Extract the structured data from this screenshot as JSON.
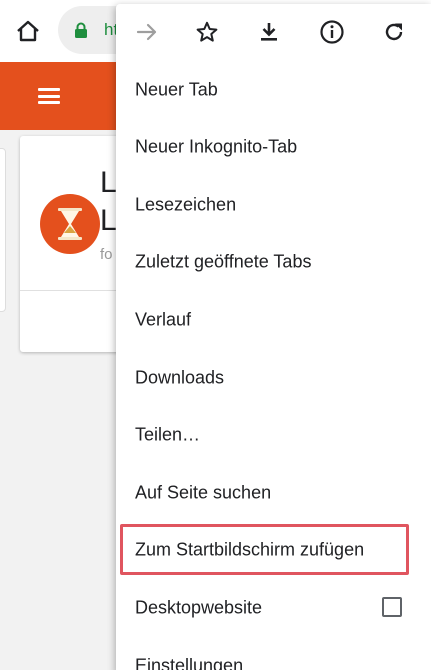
{
  "browser": {
    "url_partial": "ht",
    "icons": {
      "home": "home-icon",
      "lock": "lock-icon"
    },
    "colors": {
      "secure_green": "#1e8e3e",
      "brand_orange": "#e4501d"
    }
  },
  "page": {
    "card_title_line1": "L",
    "card_title_line2": "L",
    "card_subtitle": "fo"
  },
  "menu": {
    "toolbar": [
      "forward-icon",
      "bookmark-star-icon",
      "download-icon",
      "info-icon",
      "reload-icon"
    ],
    "items": [
      {
        "label": "Neuer Tab"
      },
      {
        "label": "Neuer Inkognito-Tab"
      },
      {
        "label": "Lesezeichen"
      },
      {
        "label": "Zuletzt geöffnete Tabs"
      },
      {
        "label": "Verlauf"
      },
      {
        "label": "Downloads"
      },
      {
        "label": "Teilen…"
      },
      {
        "label": "Auf Seite suchen"
      },
      {
        "label": "Zum Startbildschirm zufügen"
      },
      {
        "label": "Desktopwebsite",
        "checked": false
      },
      {
        "label": "Einstellungen"
      }
    ],
    "highlight_color": "#e0555f"
  }
}
